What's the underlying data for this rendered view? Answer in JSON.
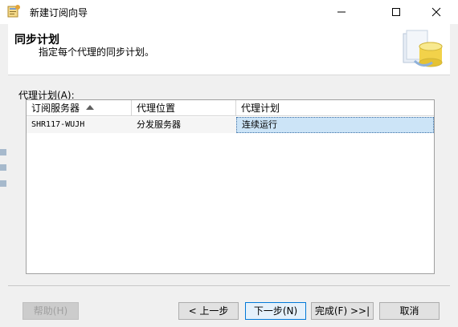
{
  "window": {
    "title": "新建订阅向导",
    "controls": {
      "minimize": "minimize-icon",
      "maximize": "maximize-icon",
      "close": "close-icon"
    }
  },
  "header": {
    "title": "同步计划",
    "subtitle": "指定每个代理的同步计划。",
    "art": "database-wizard-icon"
  },
  "agent_schedule": {
    "label": "代理计划(A):",
    "columns": [
      "订阅服务器",
      "代理位置",
      "代理计划"
    ],
    "sort_column": "订阅服务器",
    "rows": [
      {
        "subscriber": "SHR117-WUJH",
        "location": "分发服务器",
        "schedule": "连续运行"
      }
    ]
  },
  "buttons": {
    "help": "帮助(H)",
    "back": "< 上一步",
    "next": "下一步(N)",
    "finish": "完成(F) >>|",
    "cancel": "取消"
  },
  "colors": {
    "accent": "#0078d7",
    "selection": "#cce4f7",
    "background": "#f0f0f0"
  }
}
